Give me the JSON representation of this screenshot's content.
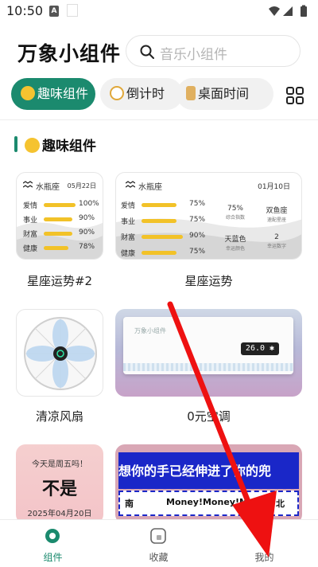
{
  "status_bar": {
    "time": "10:50",
    "notif_icon_letter": "A"
  },
  "header": {
    "title": "万象小组件",
    "search_placeholder": "音乐小组件"
  },
  "tabs": [
    {
      "label": "趣味组件",
      "icon": "laughing-emoji-icon",
      "active": true
    },
    {
      "label": "倒计时",
      "icon": "stopwatch-icon"
    },
    {
      "label": "桌面时间",
      "icon": "hourglass-icon"
    }
  ],
  "section": {
    "title": "趣味组件"
  },
  "widgets": {
    "horoscope_small": {
      "sign": "水瓶座",
      "date": "05月22日",
      "rows": [
        {
          "label": "爱情",
          "value": "100%",
          "fill": 1.0
        },
        {
          "label": "事业",
          "value": "90%",
          "fill": 0.9
        },
        {
          "label": "财富",
          "value": "90%",
          "fill": 0.9
        },
        {
          "label": "健康",
          "value": "78%",
          "fill": 0.78
        }
      ],
      "caption": "星座运势#2"
    },
    "horoscope_wide": {
      "sign": "水瓶座",
      "date": "01月10日",
      "rows": [
        {
          "label": "爱情",
          "value": "75%",
          "fill": 0.75
        },
        {
          "label": "事业",
          "value": "75%",
          "fill": 0.75
        },
        {
          "label": "财富",
          "value": "90%",
          "fill": 0.9
        },
        {
          "label": "健康",
          "value": "75%",
          "fill": 0.75
        }
      ],
      "stats": [
        {
          "value": "75%",
          "label": "综合指数"
        },
        {
          "value": "双鱼座",
          "label": "速配星座"
        },
        {
          "value": "天蓝色",
          "label": "幸运颜色"
        },
        {
          "value": "2",
          "label": "幸运数字"
        }
      ],
      "caption": "星座运势"
    },
    "fan": {
      "caption": "清凉风扇"
    },
    "ac": {
      "brand": "万象小组件",
      "temp": "26.0",
      "caption": "0元空调"
    },
    "friday": {
      "question": "今天是周五吗！",
      "answer": "不是",
      "date": "2025年04月20日"
    },
    "pocket": {
      "headline": "想你的手已经伸进了你的兜",
      "left": "南",
      "middle": "Money!Money!M",
      "right": "北"
    }
  },
  "bottom_nav": [
    {
      "label": "组件",
      "active": true
    },
    {
      "label": "收藏"
    },
    {
      "label": "我的"
    }
  ],
  "colors": {
    "accent": "#1b8a6e",
    "bar": "#f2c228",
    "arrow": "#ee1111"
  }
}
